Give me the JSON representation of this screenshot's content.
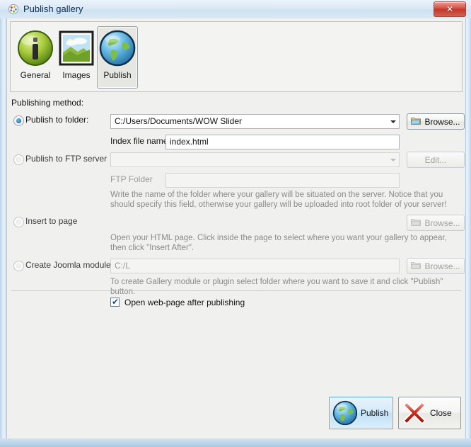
{
  "window": {
    "title": "Publish gallery",
    "title_icon": "palette-icon",
    "close_button_glyph": "✕"
  },
  "toolbar": {
    "tabs": [
      {
        "label": "General",
        "icon": "info-globe-icon",
        "selected": false
      },
      {
        "label": "Images",
        "icon": "picture-icon",
        "selected": false
      },
      {
        "label": "Publish",
        "icon": "globe-icon",
        "selected": true
      }
    ]
  },
  "form": {
    "heading": "Publishing method:",
    "publish_to_folder": {
      "radio_label": "Publish to folder:",
      "selected": true,
      "path_value": "C:/Users/Documents/WOW Slider",
      "browse_label": "Browse...",
      "browse_icon": "folder-icon",
      "browse_enabled": true,
      "index_label": "Index file name",
      "index_value": "index.html"
    },
    "publish_to_ftp": {
      "radio_label": "Publish to FTP server",
      "selected": false,
      "server_value": "",
      "edit_label": "Edit...",
      "edit_enabled": false,
      "ftp_folder_label": "FTP Folder",
      "ftp_folder_value": "",
      "hint": "Write the name of the folder where your gallery will be situated on the server. Notice that you should specify this field, otherwise your gallery will be uploaded into root folder of your server!"
    },
    "insert_to_page": {
      "radio_label": "Insert to page",
      "selected": false,
      "browse_label": "Browse...",
      "browse_icon": "folder-icon",
      "browse_enabled": false,
      "hint": "Open your HTML page. Click inside the page to select where you want your gallery to appear, then click \"Insert After\"."
    },
    "create_joomla": {
      "radio_label": "Create Joomla module",
      "selected": false,
      "path_value": "C:/L",
      "browse_label": "Browse...",
      "browse_icon": "folder-icon",
      "browse_enabled": false,
      "hint": "To create Gallery module or plugin select folder where you want to save it and click \"Publish\" button."
    },
    "open_webpage": {
      "label": "Open web-page after publishing",
      "checked": true,
      "check_glyph": "✔"
    }
  },
  "actions": {
    "publish": {
      "label": "Publish",
      "icon": "globe-icon",
      "is_default": true
    },
    "close": {
      "label": "Close",
      "icon": "red-x-icon",
      "is_default": false
    }
  },
  "colors": {
    "dialog_background": "#f0f0ee",
    "accent_blue": "#2f7fc0",
    "close_red": "#c0382c",
    "hint_gray": "#8b8b8b"
  }
}
